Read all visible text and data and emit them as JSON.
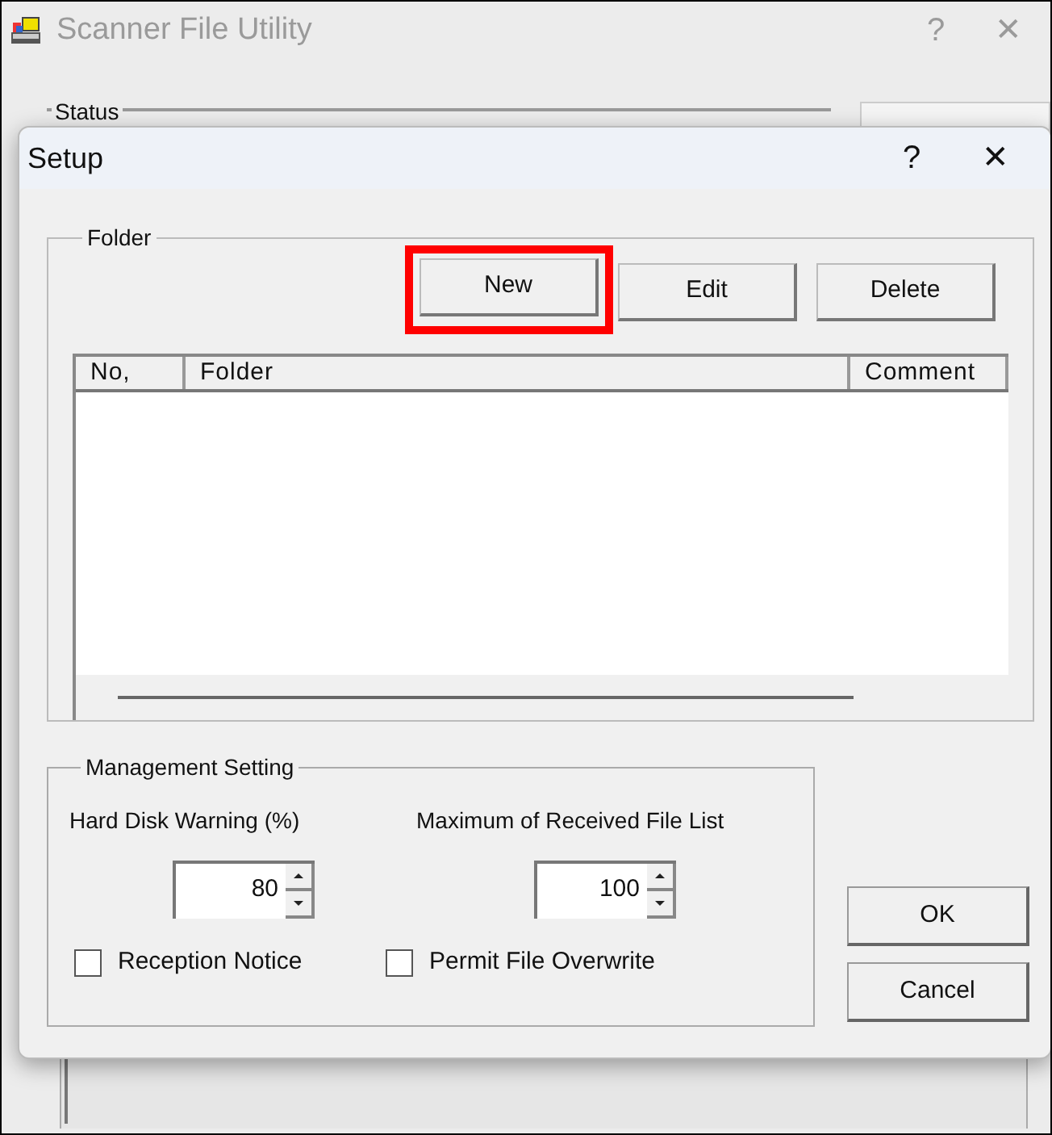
{
  "app_window": {
    "title": "Scanner File Utility",
    "help": "?",
    "close": "✕",
    "status_group": "Status"
  },
  "dialog": {
    "title": "Setup",
    "help": "?",
    "close": "✕"
  },
  "folder_group": {
    "legend": "Folder",
    "buttons": [
      {
        "label": "New",
        "highlighted": true
      },
      {
        "label": "Edit",
        "highlighted": false
      },
      {
        "label": "Delete",
        "highlighted": false
      }
    ],
    "table": {
      "columns": [
        "No,",
        "Folder",
        "Comment"
      ]
    }
  },
  "management": {
    "legend": "Management Setting",
    "spinners": [
      {
        "label": "Hard Disk Warning (%)",
        "value": "80"
      },
      {
        "label": "Maximum of Received File List",
        "value": "100"
      }
    ],
    "checkboxes": [
      {
        "label": "Reception Notice",
        "checked": false
      },
      {
        "label": "Permit File Overwrite",
        "checked": false
      }
    ]
  },
  "buttons": [
    "OK",
    "Cancel"
  ]
}
